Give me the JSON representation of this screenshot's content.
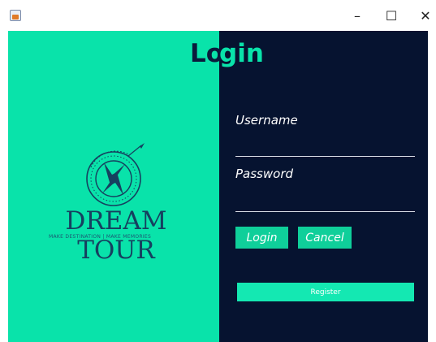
{
  "window": {
    "icon": "java-app-icon",
    "minimize_glyph": "–",
    "maximize_glyph": "☐",
    "close_glyph": "✕"
  },
  "title": {
    "part1": "Lo",
    "part2": "gin"
  },
  "logo": {
    "name": "DREAM TOUR",
    "tagline": "MAKE DESTINATION | MAKE MEMORIES",
    "icon": "compass-icon"
  },
  "form": {
    "username_label": "Username",
    "password_label": "Password",
    "username_value": "",
    "password_value": "",
    "login_label": "Login",
    "cancel_label": "Cancel",
    "register_label": "Register"
  },
  "colors": {
    "left_panel": "#09e3aa",
    "right_panel": "#061330",
    "button": "#0fcf9a",
    "logo": "#16405f"
  }
}
